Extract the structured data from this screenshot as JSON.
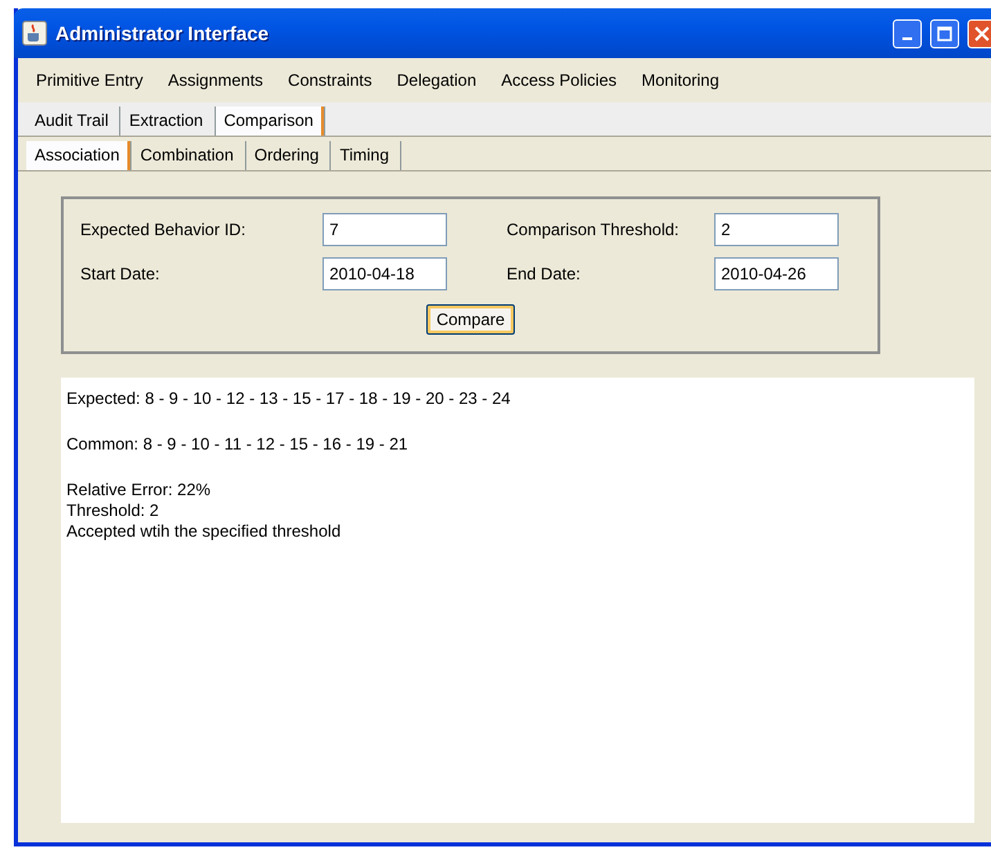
{
  "window": {
    "title": "Administrator Interface"
  },
  "menu": [
    {
      "label": "Primitive Entry"
    },
    {
      "label": "Assignments"
    },
    {
      "label": "Constraints"
    },
    {
      "label": "Delegation"
    },
    {
      "label": "Access Policies"
    },
    {
      "label": "Monitoring"
    }
  ],
  "tabs": [
    {
      "label": "Audit Trail",
      "selected": false
    },
    {
      "label": "Extraction",
      "selected": false
    },
    {
      "label": "Comparison",
      "selected": true
    }
  ],
  "subtabs": [
    {
      "label": "Association",
      "selected": true
    },
    {
      "label": "Combination",
      "selected": false
    },
    {
      "label": "Ordering",
      "selected": false
    },
    {
      "label": "Timing",
      "selected": false
    }
  ],
  "form": {
    "fields": [
      {
        "label": "Expected Behavior ID:",
        "value": "7"
      },
      {
        "label": "Comparison Threshold:",
        "value": "2"
      },
      {
        "label": "Start Date:",
        "value": "2010-04-18"
      },
      {
        "label": "End Date:",
        "value": "2010-04-26"
      }
    ],
    "button": "Compare"
  },
  "output": {
    "paragraphs": [
      [
        "Expected: 8 - 9 - 10 - 12 - 13 - 15 - 17 - 18 - 19 - 20 - 23 - 24"
      ],
      [
        "Common: 8 - 9 - 10 - 11 - 12 - 15 - 16 - 19 - 21"
      ],
      [
        "Relative Error: 22%",
        "Threshold: 2",
        "Accepted wtih the specified threshold"
      ]
    ]
  }
}
